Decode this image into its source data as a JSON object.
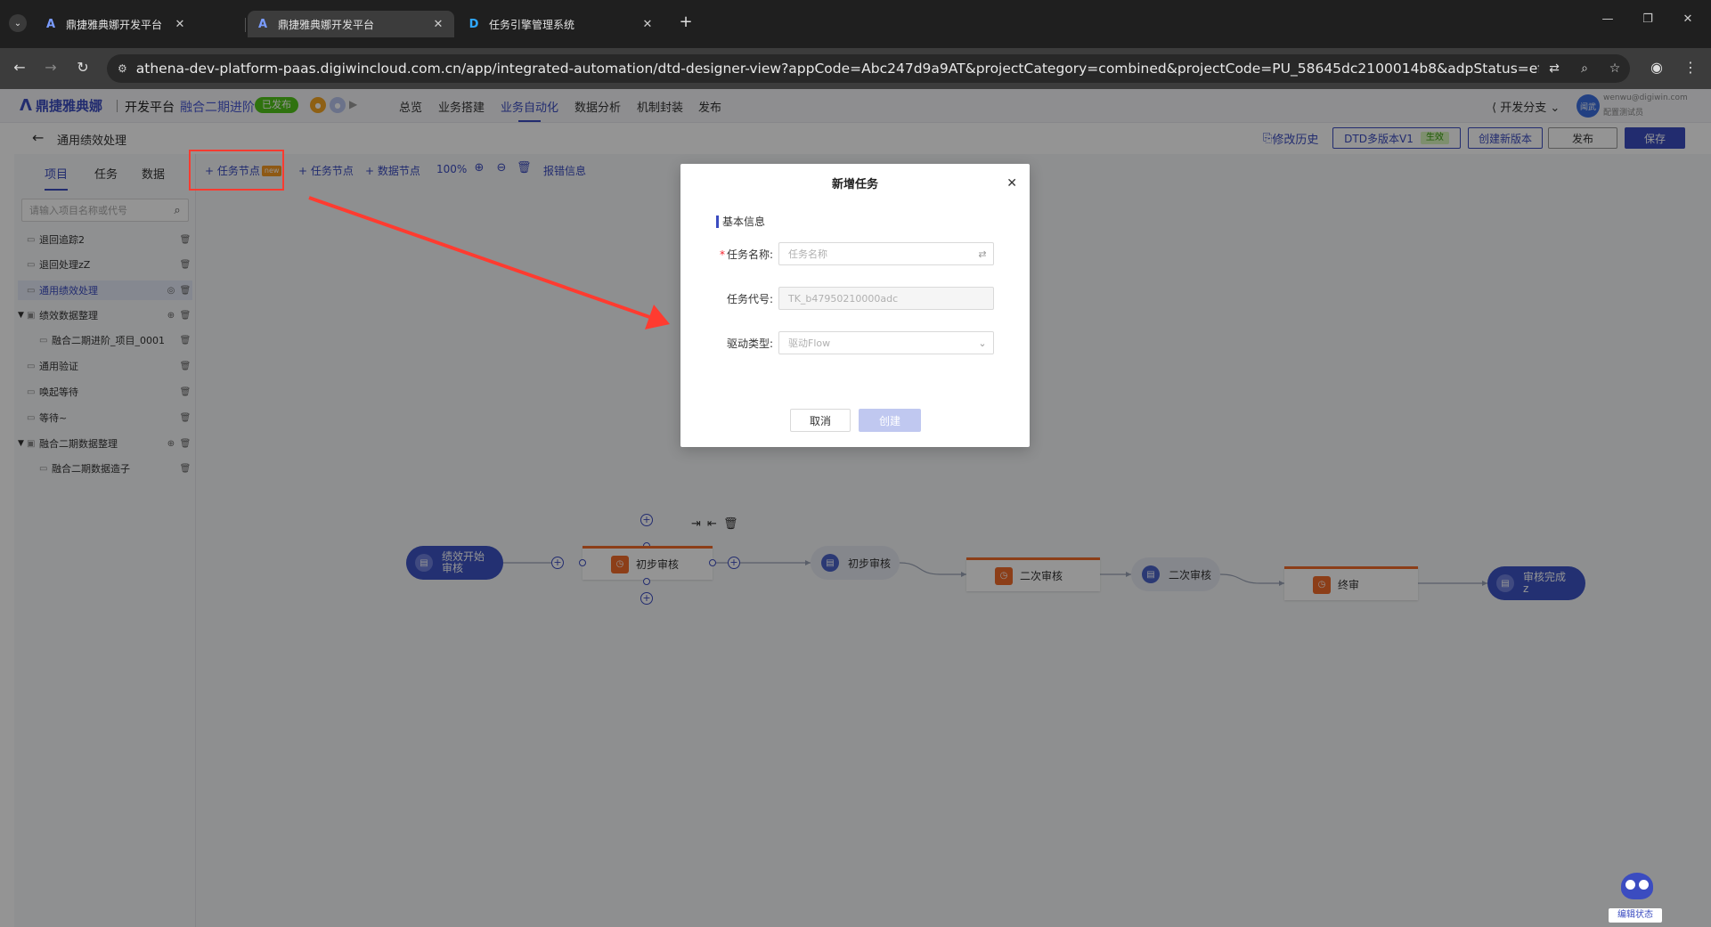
{
  "browser": {
    "tabs": [
      {
        "title": "鼎捷雅典娜开发平台",
        "favicon": "A",
        "active": false
      },
      {
        "title": "鼎捷雅典娜开发平台",
        "favicon": "A",
        "active": true
      },
      {
        "title": "任务引擎管理系统",
        "favicon": "D",
        "active": false
      }
    ],
    "url": "athena-dev-platform-paas.digiwincloud.com.cn/app/integrated-automation/dtd-designer-view?appCode=Abc247d9a9AT&projectCategory=combined&projectCode=PU_58645dc2100014b8&adpStatus=effect&adpVersion=2025052..."
  },
  "header": {
    "logo_text": "鼎捷雅典娜",
    "platform_name": "开发平台",
    "app_name": "融合二期进阶",
    "status": "已发布",
    "nav": [
      "总览",
      "业务搭建",
      "业务自动化",
      "数据分析",
      "机制封装",
      "发布"
    ],
    "nav_active_index": 2,
    "branch": "开发分支",
    "user_email": "wenwu@digiwin.com",
    "user_role": "配置测试员",
    "avatar_text": "闻武"
  },
  "page": {
    "title": "通用绩效处理",
    "actions": {
      "history": "修改历史",
      "version": "DTD多版本V1",
      "version_status": "生效",
      "new_version": "创建新版本",
      "publish": "发布",
      "save": "保存"
    }
  },
  "leftpanel": {
    "tabs": [
      "项目",
      "任务",
      "数据"
    ],
    "search_placeholder": "请输入项目名称或代号",
    "tree": [
      {
        "label": "退回追踪2",
        "level": 0,
        "selected": false
      },
      {
        "label": "退回处理zZ",
        "level": 0,
        "selected": false
      },
      {
        "label": "通用绩效处理",
        "level": 0,
        "selected": true
      },
      {
        "label": "绩效数据整理",
        "level": 0,
        "group": true,
        "selected": false
      },
      {
        "label": "融合二期进阶_项目_0001",
        "level": 1,
        "selected": false
      },
      {
        "label": "通用验证",
        "level": 0,
        "selected": false
      },
      {
        "label": "唤起等待",
        "level": 0,
        "selected": false
      },
      {
        "label": "等待~",
        "level": 0,
        "selected": false
      },
      {
        "label": "融合二期数据整理",
        "level": 0,
        "group": true,
        "selected": false
      },
      {
        "label": "融合二期数据造子",
        "level": 1,
        "selected": false
      }
    ]
  },
  "canvas": {
    "toolbar": {
      "task_node_new": "任务节点",
      "new_badge": "new",
      "task_node": "任务节点",
      "data_node": "数据节点",
      "zoom": "100%",
      "report": "报错信息"
    },
    "nodes": [
      {
        "label": "绩效开始审核",
        "line1": "绩效开始",
        "line2": "审核"
      },
      {
        "label": "初步审核"
      },
      {
        "label": "初步审核"
      },
      {
        "label": "二次审核"
      },
      {
        "label": "二次审核"
      },
      {
        "label": "终审"
      },
      {
        "label": "审核完成z",
        "line1": "审核完成",
        "line2": "z"
      }
    ]
  },
  "modal": {
    "title": "新增任务",
    "section": "基本信息",
    "fields": {
      "name_label": "任务名称:",
      "name_placeholder": "任务名称",
      "code_label": "任务代号:",
      "code_value": "TK_b47950210000adc",
      "drive_label": "驱动类型:",
      "drive_value": "驱动Flow"
    },
    "cancel": "取消",
    "create": "创建"
  },
  "mascot": {
    "label": "编辑状态"
  },
  "colors": {
    "primary": "#3b4cc0",
    "task_orange": "#f26b2a",
    "annotation_red": "#ff3b30",
    "published_green": "#52c41a"
  }
}
